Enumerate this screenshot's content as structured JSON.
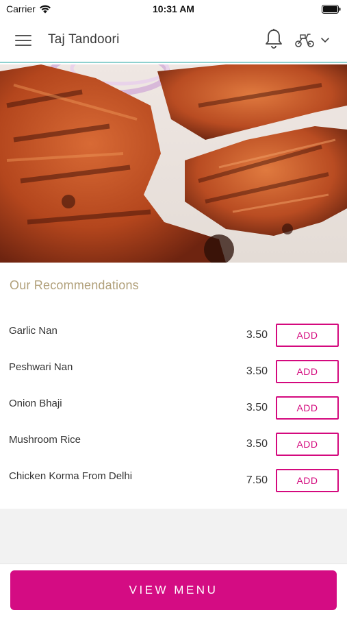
{
  "status_bar": {
    "carrier": "Carrier",
    "time": "10:31 AM"
  },
  "header": {
    "title": "Taj Tandoori",
    "icons": [
      "hamburger-menu-icon",
      "bell-icon",
      "scooter-icon",
      "chevron-down-icon"
    ]
  },
  "hero": {
    "image": "tandoori-chicken-photo"
  },
  "recommendations": {
    "title": "Our Recommendations",
    "items": [
      {
        "name": "Garlic Nan",
        "price": "3.50",
        "button": "ADD"
      },
      {
        "name": "Peshwari Nan",
        "price": "3.50",
        "button": "ADD"
      },
      {
        "name": "Onion Bhaji",
        "price": "3.50",
        "button": "ADD"
      },
      {
        "name": "Mushroom Rice",
        "price": "3.50",
        "button": "ADD"
      },
      {
        "name": "Chicken Korma From Delhi",
        "price": "7.50",
        "button": "ADD"
      }
    ]
  },
  "footer": {
    "button_label": "VIEW MENU"
  },
  "colors": {
    "accent": "#d40c83",
    "section_title": "#b1a07a",
    "header_border": "#8fd1cf"
  }
}
